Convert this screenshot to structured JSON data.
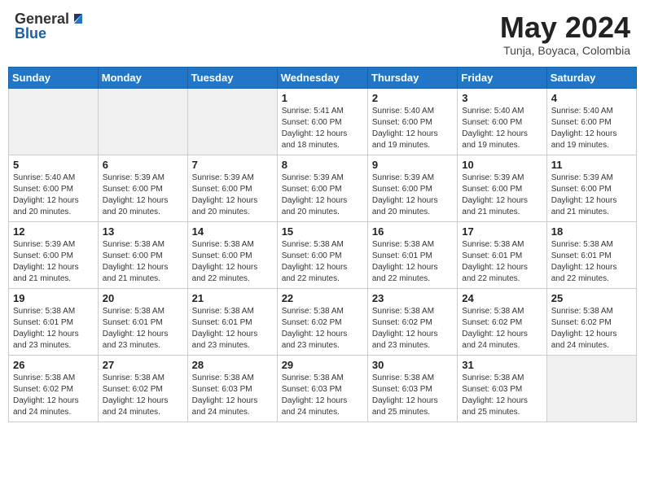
{
  "logo": {
    "general": "General",
    "blue": "Blue"
  },
  "header": {
    "month": "May 2024",
    "location": "Tunja, Boyaca, Colombia"
  },
  "weekdays": [
    "Sunday",
    "Monday",
    "Tuesday",
    "Wednesday",
    "Thursday",
    "Friday",
    "Saturday"
  ],
  "weeks": [
    [
      {
        "day": "",
        "info": ""
      },
      {
        "day": "",
        "info": ""
      },
      {
        "day": "",
        "info": ""
      },
      {
        "day": "1",
        "info": "Sunrise: 5:41 AM\nSunset: 6:00 PM\nDaylight: 12 hours\nand 18 minutes."
      },
      {
        "day": "2",
        "info": "Sunrise: 5:40 AM\nSunset: 6:00 PM\nDaylight: 12 hours\nand 19 minutes."
      },
      {
        "day": "3",
        "info": "Sunrise: 5:40 AM\nSunset: 6:00 PM\nDaylight: 12 hours\nand 19 minutes."
      },
      {
        "day": "4",
        "info": "Sunrise: 5:40 AM\nSunset: 6:00 PM\nDaylight: 12 hours\nand 19 minutes."
      }
    ],
    [
      {
        "day": "5",
        "info": "Sunrise: 5:40 AM\nSunset: 6:00 PM\nDaylight: 12 hours\nand 20 minutes."
      },
      {
        "day": "6",
        "info": "Sunrise: 5:39 AM\nSunset: 6:00 PM\nDaylight: 12 hours\nand 20 minutes."
      },
      {
        "day": "7",
        "info": "Sunrise: 5:39 AM\nSunset: 6:00 PM\nDaylight: 12 hours\nand 20 minutes."
      },
      {
        "day": "8",
        "info": "Sunrise: 5:39 AM\nSunset: 6:00 PM\nDaylight: 12 hours\nand 20 minutes."
      },
      {
        "day": "9",
        "info": "Sunrise: 5:39 AM\nSunset: 6:00 PM\nDaylight: 12 hours\nand 20 minutes."
      },
      {
        "day": "10",
        "info": "Sunrise: 5:39 AM\nSunset: 6:00 PM\nDaylight: 12 hours\nand 21 minutes."
      },
      {
        "day": "11",
        "info": "Sunrise: 5:39 AM\nSunset: 6:00 PM\nDaylight: 12 hours\nand 21 minutes."
      }
    ],
    [
      {
        "day": "12",
        "info": "Sunrise: 5:39 AM\nSunset: 6:00 PM\nDaylight: 12 hours\nand 21 minutes."
      },
      {
        "day": "13",
        "info": "Sunrise: 5:38 AM\nSunset: 6:00 PM\nDaylight: 12 hours\nand 21 minutes."
      },
      {
        "day": "14",
        "info": "Sunrise: 5:38 AM\nSunset: 6:00 PM\nDaylight: 12 hours\nand 22 minutes."
      },
      {
        "day": "15",
        "info": "Sunrise: 5:38 AM\nSunset: 6:00 PM\nDaylight: 12 hours\nand 22 minutes."
      },
      {
        "day": "16",
        "info": "Sunrise: 5:38 AM\nSunset: 6:01 PM\nDaylight: 12 hours\nand 22 minutes."
      },
      {
        "day": "17",
        "info": "Sunrise: 5:38 AM\nSunset: 6:01 PM\nDaylight: 12 hours\nand 22 minutes."
      },
      {
        "day": "18",
        "info": "Sunrise: 5:38 AM\nSunset: 6:01 PM\nDaylight: 12 hours\nand 22 minutes."
      }
    ],
    [
      {
        "day": "19",
        "info": "Sunrise: 5:38 AM\nSunset: 6:01 PM\nDaylight: 12 hours\nand 23 minutes."
      },
      {
        "day": "20",
        "info": "Sunrise: 5:38 AM\nSunset: 6:01 PM\nDaylight: 12 hours\nand 23 minutes."
      },
      {
        "day": "21",
        "info": "Sunrise: 5:38 AM\nSunset: 6:01 PM\nDaylight: 12 hours\nand 23 minutes."
      },
      {
        "day": "22",
        "info": "Sunrise: 5:38 AM\nSunset: 6:02 PM\nDaylight: 12 hours\nand 23 minutes."
      },
      {
        "day": "23",
        "info": "Sunrise: 5:38 AM\nSunset: 6:02 PM\nDaylight: 12 hours\nand 23 minutes."
      },
      {
        "day": "24",
        "info": "Sunrise: 5:38 AM\nSunset: 6:02 PM\nDaylight: 12 hours\nand 24 minutes."
      },
      {
        "day": "25",
        "info": "Sunrise: 5:38 AM\nSunset: 6:02 PM\nDaylight: 12 hours\nand 24 minutes."
      }
    ],
    [
      {
        "day": "26",
        "info": "Sunrise: 5:38 AM\nSunset: 6:02 PM\nDaylight: 12 hours\nand 24 minutes."
      },
      {
        "day": "27",
        "info": "Sunrise: 5:38 AM\nSunset: 6:02 PM\nDaylight: 12 hours\nand 24 minutes."
      },
      {
        "day": "28",
        "info": "Sunrise: 5:38 AM\nSunset: 6:03 PM\nDaylight: 12 hours\nand 24 minutes."
      },
      {
        "day": "29",
        "info": "Sunrise: 5:38 AM\nSunset: 6:03 PM\nDaylight: 12 hours\nand 24 minutes."
      },
      {
        "day": "30",
        "info": "Sunrise: 5:38 AM\nSunset: 6:03 PM\nDaylight: 12 hours\nand 25 minutes."
      },
      {
        "day": "31",
        "info": "Sunrise: 5:38 AM\nSunset: 6:03 PM\nDaylight: 12 hours\nand 25 minutes."
      },
      {
        "day": "",
        "info": ""
      }
    ]
  ],
  "colors": {
    "header_bg": "#2176c7",
    "header_text": "#ffffff",
    "border": "#cccccc",
    "shade": "#f0f0f0"
  }
}
